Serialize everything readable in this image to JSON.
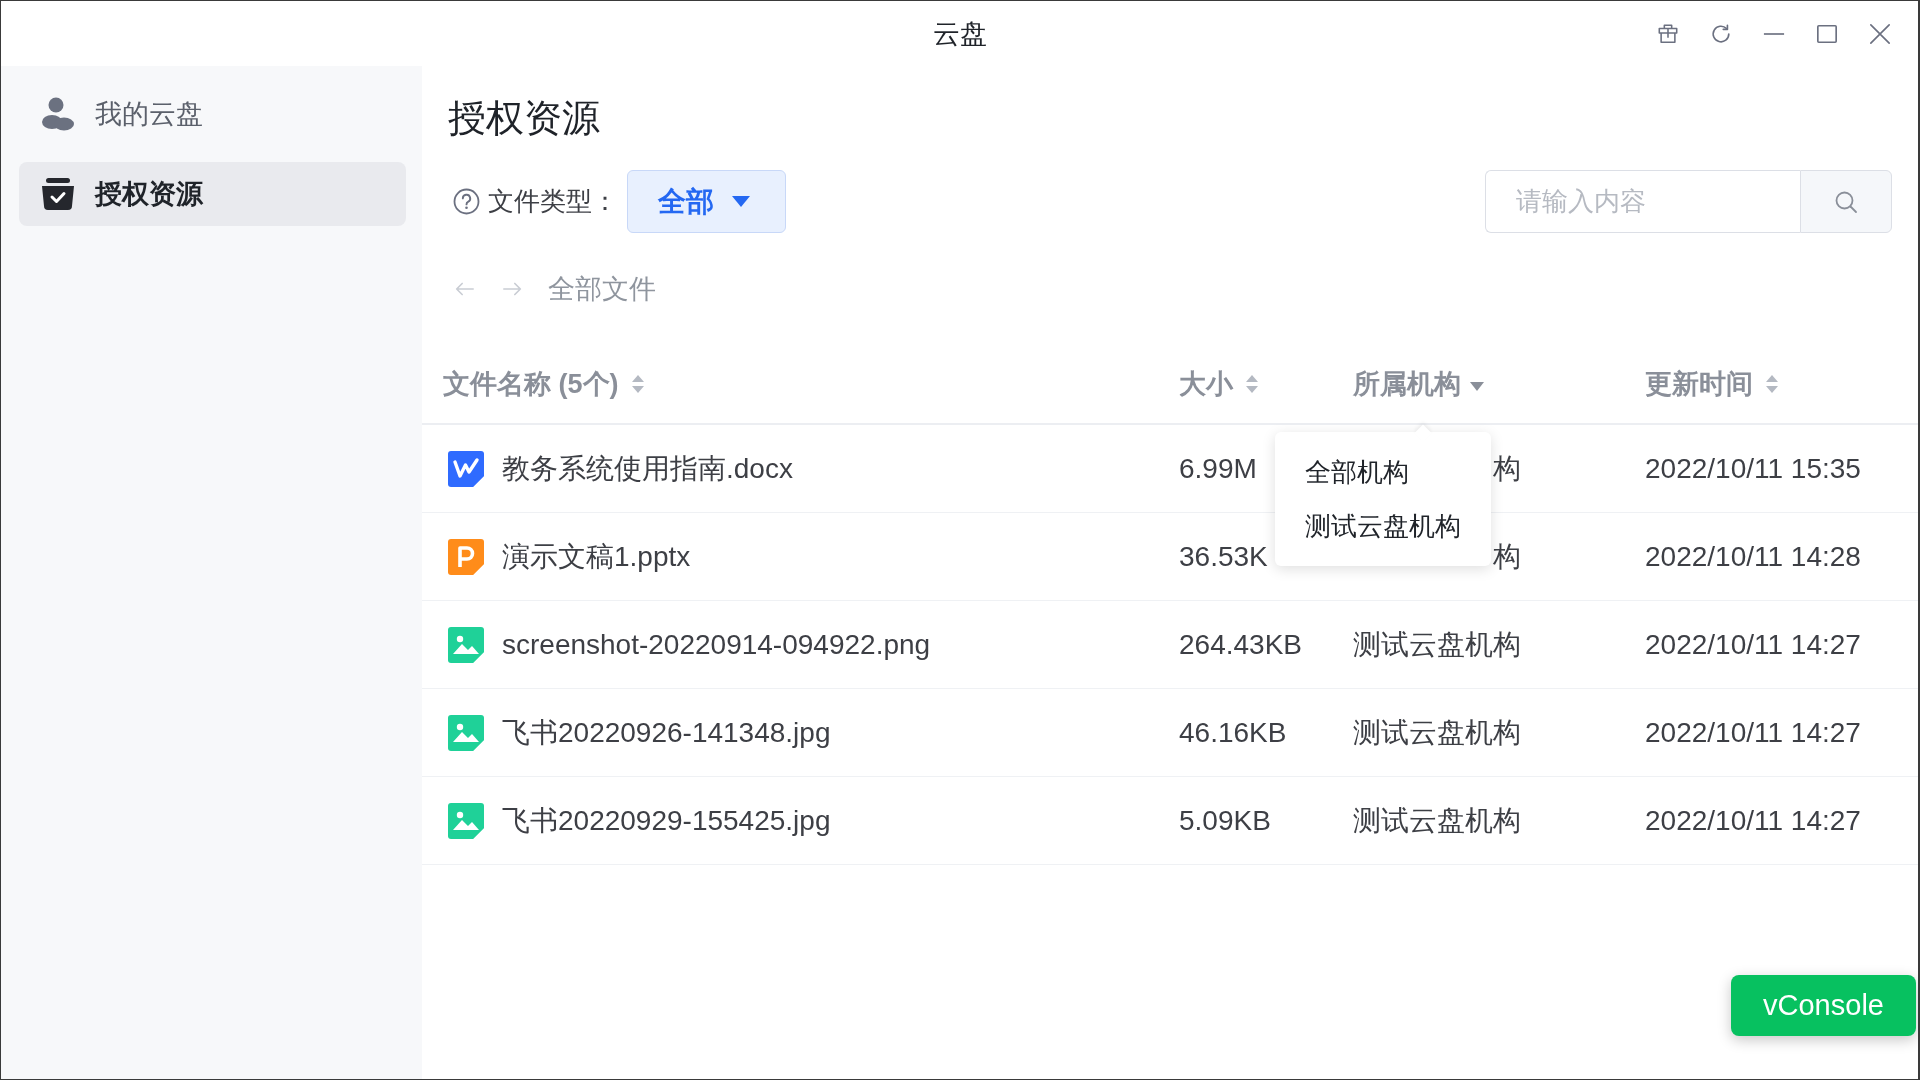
{
  "window": {
    "title": "云盘"
  },
  "sidebar": {
    "items": [
      {
        "label": "我的云盘",
        "kind": "user",
        "selected": false
      },
      {
        "label": "授权资源",
        "kind": "authorized",
        "selected": true
      }
    ]
  },
  "page": {
    "title": "授权资源"
  },
  "filter": {
    "label": "文件类型：",
    "value": "全部"
  },
  "search": {
    "placeholder": "请输入内容"
  },
  "breadcrumb": {
    "back": {
      "disabled": true
    },
    "forward": {
      "disabled": true
    },
    "path": "全部文件"
  },
  "table": {
    "columns": [
      {
        "label": "文件名称 (5个)",
        "kind": "sort"
      },
      {
        "label": "大小",
        "kind": "sort"
      },
      {
        "label": "所属机构",
        "kind": "filter"
      },
      {
        "label": "更新时间",
        "kind": "sort"
      }
    ],
    "rows": [
      {
        "kind": "doc",
        "name": "教务系统使用指南.docx",
        "size": "6.99M",
        "org": "构",
        "updated": "2022/10/11 15:35"
      },
      {
        "kind": "slides",
        "name": "演示文稿1.pptx",
        "size": "36.53K",
        "org": "构",
        "updated": "2022/10/11 14:28"
      },
      {
        "kind": "image",
        "name": "screenshot-20220914-094922.png",
        "size": "264.43KB",
        "org": "测试云盘机构",
        "updated": "2022/10/11 14:27"
      },
      {
        "kind": "image",
        "name": "飞书20220926-141348.jpg",
        "size": "46.16KB",
        "org": "测试云盘机构",
        "updated": "2022/10/11 14:27"
      },
      {
        "kind": "image",
        "name": "飞书20220929-155425.jpg",
        "size": "5.09KB",
        "org": "测试云盘机构",
        "updated": "2022/10/11 14:27"
      }
    ]
  },
  "org_menu": {
    "items": [
      {
        "label": "全部机构"
      },
      {
        "label": "测试云盘机构"
      }
    ]
  },
  "debug_button": {
    "label": "vConsole"
  }
}
